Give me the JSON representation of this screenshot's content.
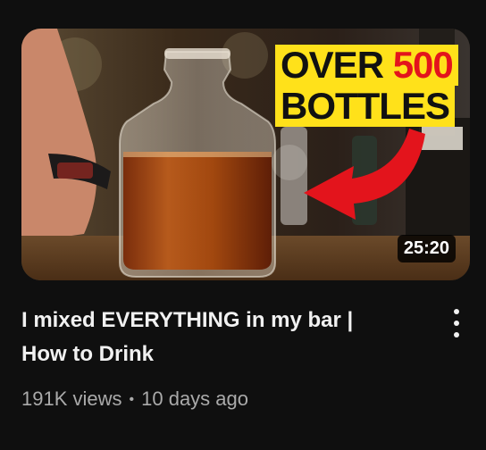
{
  "video": {
    "title_line1": "I mixed EVERYTHING in my bar |",
    "title_line2": "How to Drink",
    "views": "191K views",
    "separator": "•",
    "age": "10 days ago",
    "duration": "25:20",
    "thumbnail_text": {
      "word1": "OVER",
      "word2": "500",
      "line2": "BOTTLES"
    }
  },
  "icons": {
    "more": "more-vert-icon"
  },
  "colors": {
    "background": "#0f0f0f",
    "title": "#f1f1f1",
    "meta": "#aaaaaa",
    "overlay_yellow": "#ffe11a",
    "overlay_red": "#e3141c"
  }
}
